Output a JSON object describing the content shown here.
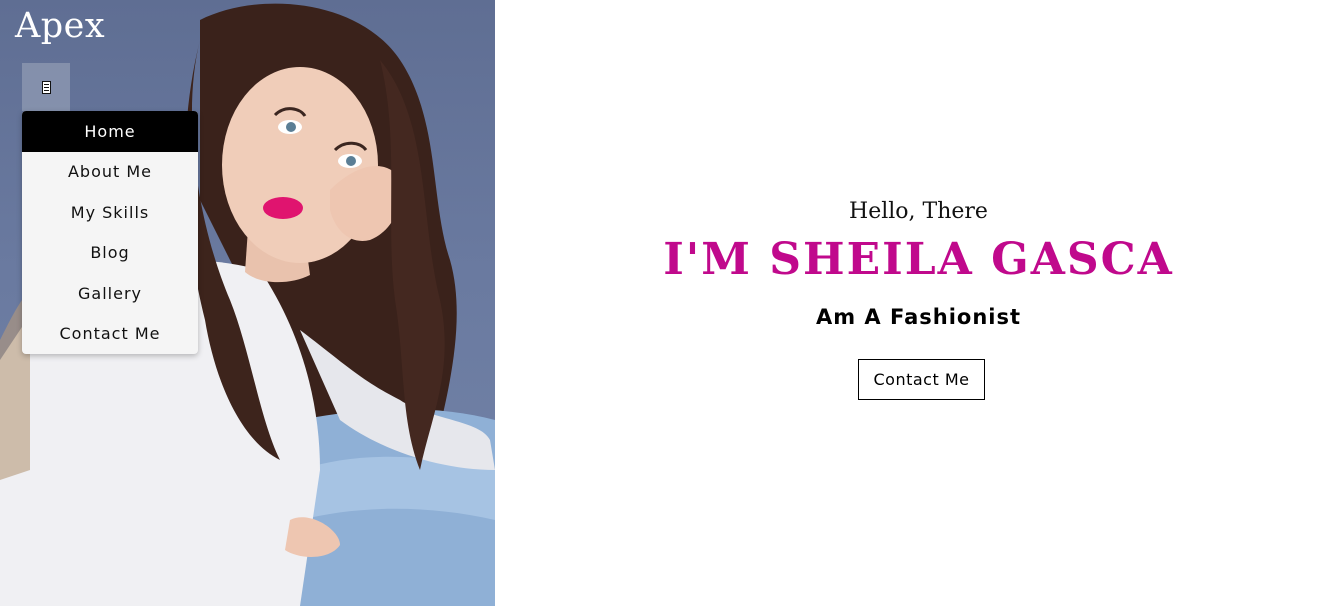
{
  "brand": {
    "name": "Apex"
  },
  "menu": {
    "toggle_icon": "menu-icon",
    "items": [
      {
        "label": "Home",
        "active": true
      },
      {
        "label": "About Me",
        "active": false
      },
      {
        "label": "My Skills",
        "active": false
      },
      {
        "label": "Blog",
        "active": false
      },
      {
        "label": "Gallery",
        "active": false
      },
      {
        "label": "Contact Me",
        "active": false
      }
    ]
  },
  "hero": {
    "greeting": "Hello, There",
    "name": "I'M SHEILA GASCA",
    "role": "Am A Fashionist",
    "cta_label": "Contact Me"
  },
  "colors": {
    "accent": "#c0098c",
    "menu_active_bg": "#000000",
    "menu_bg": "#f5f5f5"
  }
}
